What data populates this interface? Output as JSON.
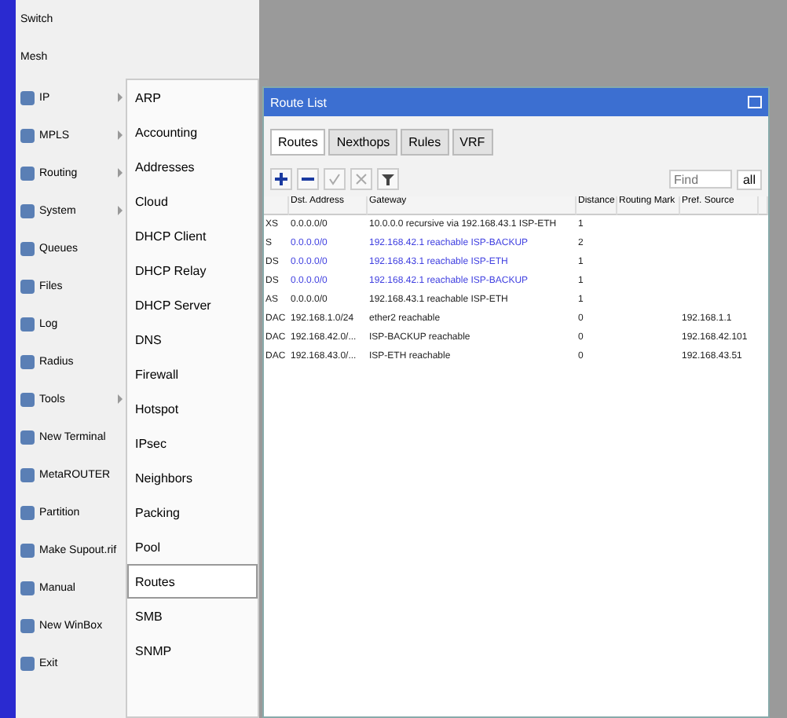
{
  "top_menu": [
    {
      "label": "Switch"
    },
    {
      "label": "Mesh"
    }
  ],
  "menu": [
    {
      "label": "IP",
      "arrow": true
    },
    {
      "label": "MPLS",
      "arrow": true
    },
    {
      "label": "Routing",
      "arrow": true
    },
    {
      "label": "System",
      "arrow": true
    },
    {
      "label": "Queues",
      "arrow": false
    },
    {
      "label": "Files",
      "arrow": false
    },
    {
      "label": "Log",
      "arrow": false
    },
    {
      "label": "Radius",
      "arrow": false
    },
    {
      "label": "Tools",
      "arrow": true
    },
    {
      "label": "New Terminal",
      "arrow": false
    },
    {
      "label": "MetaROUTER",
      "arrow": false
    },
    {
      "label": "Partition",
      "arrow": false
    },
    {
      "label": "Make Supout.rif",
      "arrow": false
    },
    {
      "label": "Manual",
      "arrow": false
    },
    {
      "label": "New WinBox",
      "arrow": false
    },
    {
      "label": "Exit",
      "arrow": false
    }
  ],
  "submenu": [
    {
      "label": "ARP",
      "selected": false
    },
    {
      "label": "Accounting",
      "selected": false
    },
    {
      "label": "Addresses",
      "selected": false
    },
    {
      "label": "Cloud",
      "selected": false
    },
    {
      "label": "DHCP Client",
      "selected": false
    },
    {
      "label": "DHCP Relay",
      "selected": false
    },
    {
      "label": "DHCP Server",
      "selected": false
    },
    {
      "label": "DNS",
      "selected": false
    },
    {
      "label": "Firewall",
      "selected": false
    },
    {
      "label": "Hotspot",
      "selected": false
    },
    {
      "label": "IPsec",
      "selected": false
    },
    {
      "label": "Neighbors",
      "selected": false
    },
    {
      "label": "Packing",
      "selected": false
    },
    {
      "label": "Pool",
      "selected": false
    },
    {
      "label": "Routes",
      "selected": true
    },
    {
      "label": "SMB",
      "selected": false
    },
    {
      "label": "SNMP",
      "selected": false
    }
  ],
  "window": {
    "title": "Route List"
  },
  "tabs": [
    {
      "label": "Routes",
      "selected": true
    },
    {
      "label": "Nexthops",
      "selected": false
    },
    {
      "label": "Rules",
      "selected": false
    },
    {
      "label": "VRF",
      "selected": false
    }
  ],
  "toolbar": {
    "find_placeholder": "Find",
    "filter": "all"
  },
  "table": {
    "columns": [
      "",
      "Dst. Address",
      "Gateway",
      "Distance",
      "Routing Mark",
      "Pref. Source"
    ],
    "rows": [
      {
        "flags": "XS",
        "dst": "0.0.0.0/0",
        "gateway": "10.0.0.0 recursive via 192.168.43.1 ISP-ETH",
        "distance": "1",
        "inactive": false
      },
      {
        "flags": "S",
        "dst": "0.0.0.0/0",
        "gateway": "192.168.42.1 reachable ISP-BACKUP",
        "distance": "2",
        "inactive": true
      },
      {
        "flags": "DS",
        "dst": "0.0.0.0/0",
        "gateway": "192.168.43.1 reachable ISP-ETH",
        "distance": "1",
        "inactive": true
      },
      {
        "flags": "DS",
        "dst": "0.0.0.0/0",
        "gateway": "192.168.42.1 reachable ISP-BACKUP",
        "distance": "1",
        "inactive": true
      },
      {
        "flags": "AS",
        "dst": "0.0.0.0/0",
        "gateway": "192.168.43.1 reachable ISP-ETH",
        "distance": "1",
        "inactive": false
      },
      {
        "flags": "DAC",
        "dst": "192.168.1.0/24",
        "gateway": "ether2 reachable",
        "distance": "0",
        "pref": "192.168.1.1",
        "inactive": false
      },
      {
        "flags": "DAC",
        "dst": "192.168.42.0/...",
        "gateway": "ISP-BACKUP reachable",
        "distance": "0",
        "pref": "192.168.42.101",
        "inactive": false
      },
      {
        "flags": "DAC",
        "dst": "192.168.43.0/...",
        "gateway": "ISP-ETH reachable",
        "distance": "0",
        "pref": "192.168.43.51",
        "inactive": false
      }
    ]
  }
}
